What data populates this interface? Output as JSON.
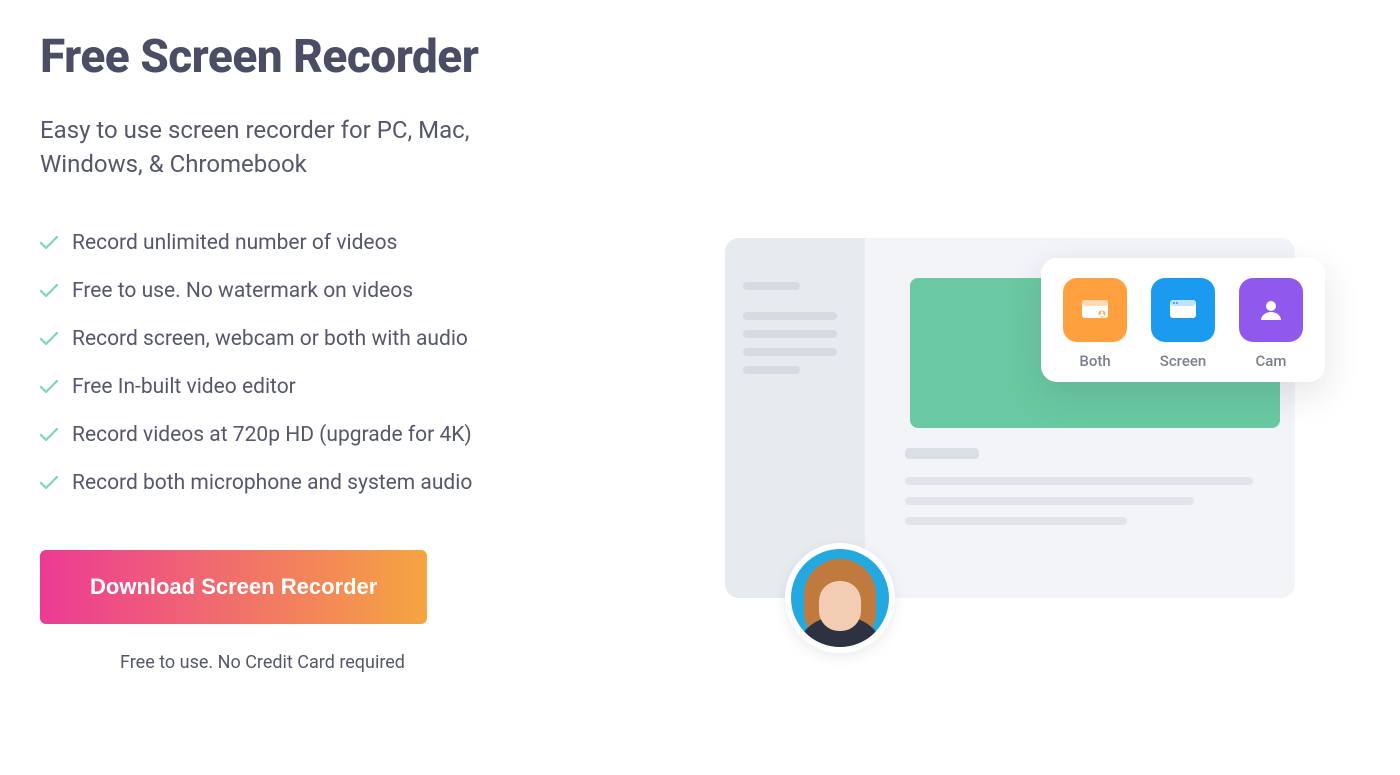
{
  "hero": {
    "title": "Free Screen Recorder",
    "subtitle": "Easy to use screen recorder for PC, Mac, Windows, & Chromebook",
    "features": [
      "Record unlimited number of videos",
      "Free to use. No watermark on videos",
      "Record screen, webcam or both with audio",
      "Free In-built video editor",
      "Record videos at 720p HD (upgrade for 4K)",
      "Record both microphone and system audio"
    ],
    "download_button": "Download Screen Recorder",
    "footnote": "Free to use. No Credit Card required"
  },
  "modes": {
    "both": "Both",
    "screen": "Screen",
    "cam": "Cam"
  },
  "colors": {
    "heading": "#4a4d63",
    "text": "#55586c",
    "check": "#7cd6b8",
    "button_gradient_start": "#ec3a95",
    "button_gradient_end": "#f6a540",
    "mode_both": "#ff9f3e",
    "mode_screen": "#1a9bf0",
    "mode_cam": "#9158ed"
  }
}
